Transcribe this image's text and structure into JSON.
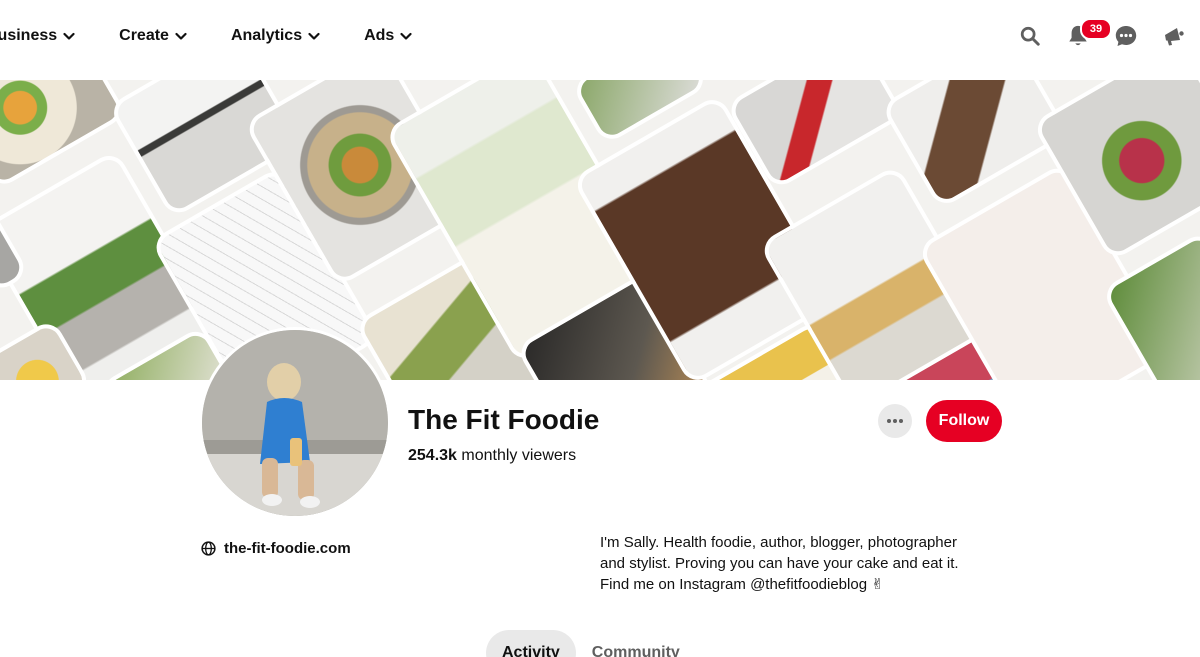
{
  "nav": {
    "menus": [
      {
        "label": "Business"
      },
      {
        "label": "Create"
      },
      {
        "label": "Analytics"
      },
      {
        "label": "Ads"
      }
    ],
    "notification_count": "39",
    "icons": [
      "search-icon",
      "bell-icon",
      "chat-icon",
      "megaphone-icon"
    ]
  },
  "profile": {
    "name": "The Fit Foodie",
    "viewers_count": "254.3k",
    "viewers_label": "monthly viewers",
    "follow_label": "Follow",
    "website": "the-fit-foodie.com",
    "bio_lines": [
      "I'm Sally. Health foodie, author, blogger, photographer",
      "and stylist. Proving you can have your cake and eat it.",
      "Find me on Instagram @thefitfoodieblog ✌"
    ]
  },
  "tabs": [
    {
      "label": "Activity",
      "active": true
    },
    {
      "label": "Community",
      "active": false
    }
  ],
  "colors": {
    "brand": "#e60023",
    "chip_bg": "#e9e9e9"
  }
}
